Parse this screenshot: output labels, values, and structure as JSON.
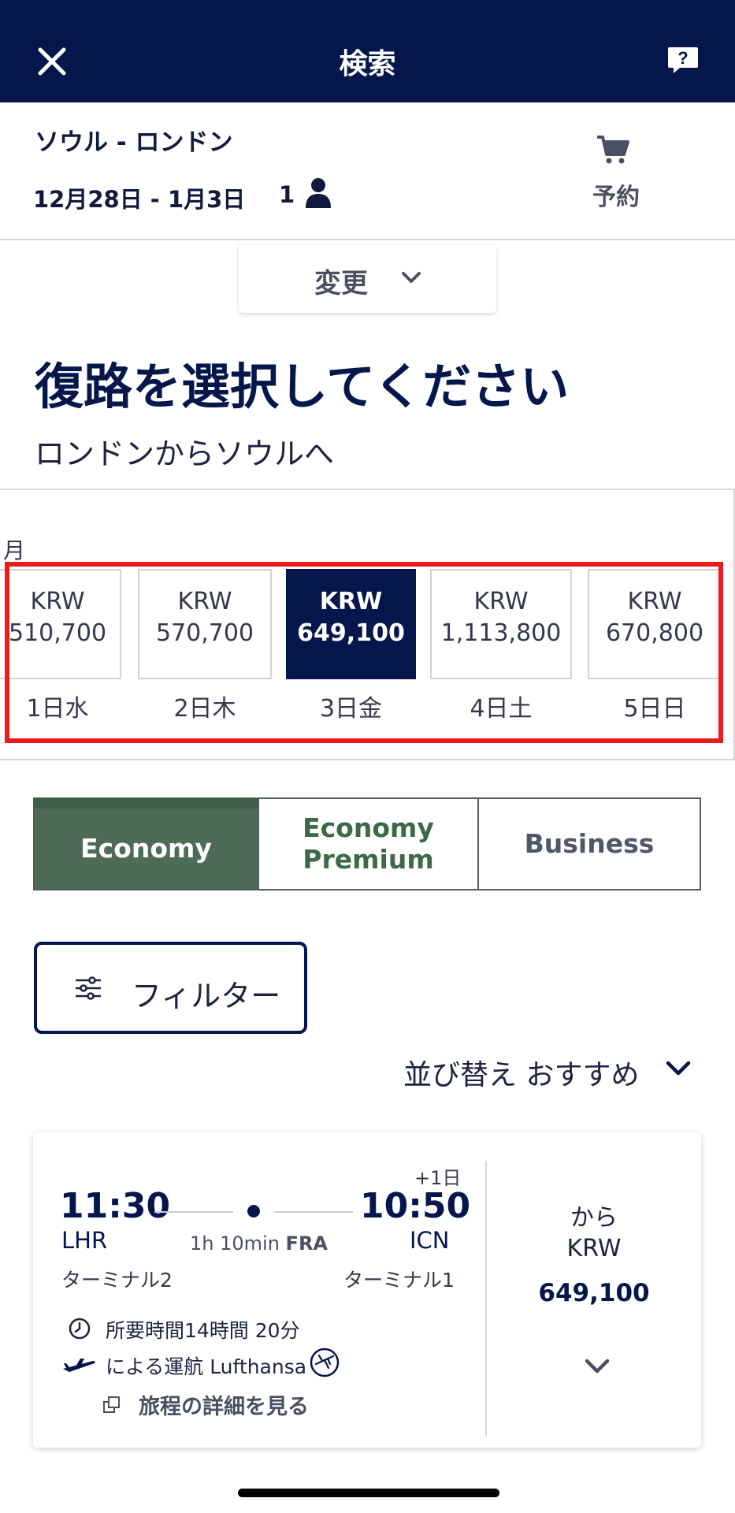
{
  "header": {
    "title": "検索",
    "close_icon": "close-icon",
    "help_icon": "help-chat-icon"
  },
  "summary": {
    "route": "ソウル - ロンドン",
    "dates": "12月28日 - 1月3日",
    "passengers": "1",
    "booking_label": "予約"
  },
  "change_button": {
    "label": "変更"
  },
  "page_heading": "復路を選択してください",
  "page_subheading": "ロンドンからソウルへ",
  "date_strip": {
    "month_label": "月",
    "items": [
      {
        "currency": "KRW",
        "price": "510,700",
        "day": "1日水",
        "selected": false
      },
      {
        "currency": "KRW",
        "price": "570,700",
        "day": "2日木",
        "selected": false
      },
      {
        "currency": "KRW",
        "price": "649,100",
        "day": "3日金",
        "selected": true
      },
      {
        "currency": "KRW",
        "price": "1,113,800",
        "day": "4日土",
        "selected": false
      },
      {
        "currency": "KRW",
        "price": "670,800",
        "day": "5日日",
        "selected": false
      }
    ]
  },
  "cabin_tabs": [
    {
      "label": "Economy",
      "active": true
    },
    {
      "label": "Economy Premium",
      "active": false
    },
    {
      "label": "Business",
      "active": false
    }
  ],
  "filter_button": {
    "label": "フィルター"
  },
  "sort": {
    "label": "並び替え おすすめ"
  },
  "flight_card": {
    "departure_time": "11:30",
    "arrival_time": "10:50",
    "day_offset": "+1日",
    "departure_airport": "LHR",
    "arrival_airport": "ICN",
    "stop_duration": "1h 10min",
    "stop_airport": "FRA",
    "departure_terminal": "ターミナル2",
    "arrival_terminal": "ターミナル1",
    "total_duration": "所要時間14時間 20分",
    "operated_by": "による運航 Lufthansa",
    "details_link": "旅程の詳細を見る",
    "price_prefix": "から",
    "currency": "KRW",
    "price": "649,100"
  },
  "colors": {
    "brand_navy": "#05164d",
    "economy_active": "#4e6b57",
    "highlight_red": "#ee1b1b"
  }
}
